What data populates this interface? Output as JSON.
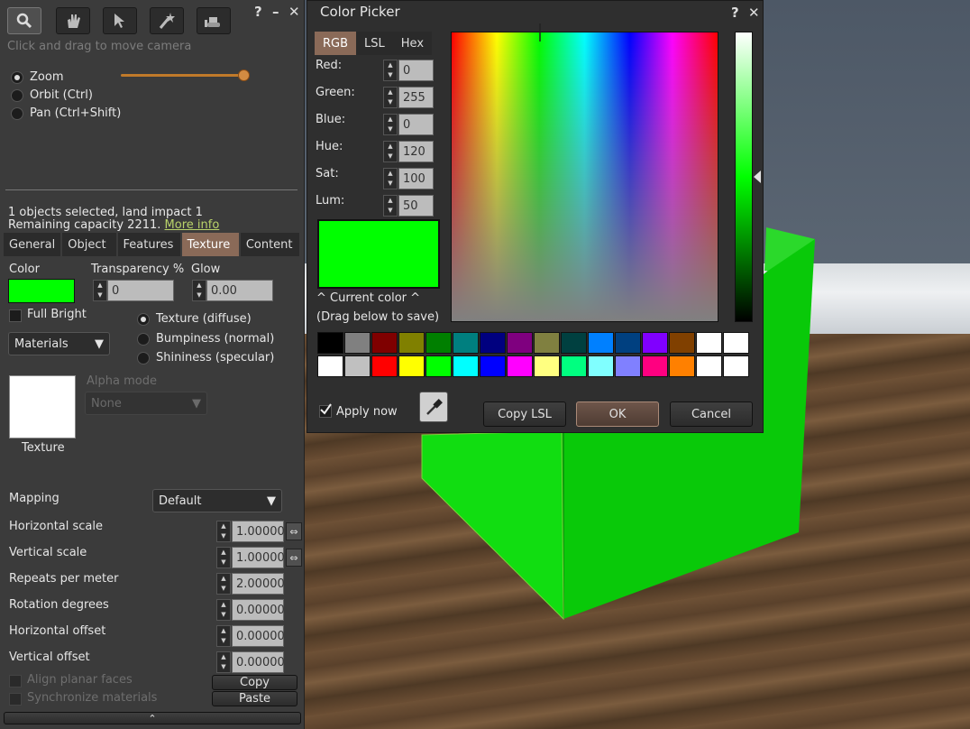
{
  "build_panel": {
    "tools": [
      "focus-icon",
      "move-icon",
      "edit-icon",
      "create-icon",
      "land-icon"
    ],
    "help": "?",
    "minimize": "–",
    "close": "✕",
    "hint": "Click and drag to move camera",
    "modes": [
      {
        "label": "Zoom",
        "selected": true
      },
      {
        "label": "Orbit (Ctrl)",
        "selected": false
      },
      {
        "label": "Pan (Ctrl+Shift)",
        "selected": false
      }
    ],
    "selection_info": "1 objects selected, land impact 1",
    "capacity_info": "Remaining capacity 2211.",
    "more_info": "More info",
    "tabs": [
      "General",
      "Object",
      "Features",
      "Texture",
      "Content"
    ],
    "active_tab": "Texture",
    "color_label": "Color",
    "transparency_label": "Transparency %",
    "transparency_value": "0",
    "glow_label": "Glow",
    "glow_value": "0.00",
    "full_bright": "Full Bright",
    "materials": "Materials",
    "texture_modes": [
      {
        "label": "Texture (diffuse)",
        "selected": true
      },
      {
        "label": "Bumpiness (normal)",
        "selected": false
      },
      {
        "label": "Shininess (specular)",
        "selected": false
      }
    ],
    "alpha_mode_label": "Alpha mode",
    "alpha_mode_value": "None",
    "texture_label": "Texture",
    "mapping_label": "Mapping",
    "mapping_value": "Default",
    "rows": [
      {
        "label": "Horizontal scale",
        "value": "1.00000"
      },
      {
        "label": "Vertical scale",
        "value": "1.00000"
      },
      {
        "label": "Repeats per meter",
        "value": "2.00000"
      },
      {
        "label": "Rotation degrees",
        "value": "0.00000"
      },
      {
        "label": "Horizontal offset",
        "value": "0.00000"
      },
      {
        "label": "Vertical offset",
        "value": "0.00000"
      }
    ],
    "align_planar": "Align planar faces",
    "sync_materials": "Synchronize materials",
    "copy": "Copy",
    "paste": "Paste",
    "expand": "⌃"
  },
  "color_picker": {
    "title": "Color Picker",
    "help": "?",
    "close": "✕",
    "tabs": [
      "RGB",
      "LSL",
      "Hex"
    ],
    "fields": [
      {
        "label": "Red:",
        "value": "0"
      },
      {
        "label": "Green:",
        "value": "255"
      },
      {
        "label": "Blue:",
        "value": "0"
      },
      {
        "label": "Hue:",
        "value": "120"
      },
      {
        "label": "Sat:",
        "value": "100"
      },
      {
        "label": "Lum:",
        "value": "50"
      }
    ],
    "current_color_label": "^ Current color ^",
    "drag_hint": "(Drag below to save)",
    "current_color": "#00ff00",
    "palette": [
      "#000000",
      "#808080",
      "#7f0000",
      "#808000",
      "#007f00",
      "#007f7f",
      "#00007f",
      "#7f007f",
      "#808040",
      "#004040",
      "#0080ff",
      "#004080",
      "#8000ff",
      "#804000",
      "#ffffff",
      "#ffffff",
      "#ffffff",
      "#c0c0c0",
      "#ff0000",
      "#ffff00",
      "#00ff00",
      "#00ffff",
      "#0000ff",
      "#ff00ff",
      "#ffff80",
      "#00ff80",
      "#80ffff",
      "#8080ff",
      "#ff0080",
      "#ff8000",
      "#ffffff",
      "#ffffff"
    ],
    "apply_now": "Apply now",
    "copy_lsl": "Copy LSL",
    "ok": "OK",
    "cancel": "Cancel"
  },
  "colors": {
    "accent_tab": "#8a6a58",
    "object_color": "#00ff00"
  }
}
